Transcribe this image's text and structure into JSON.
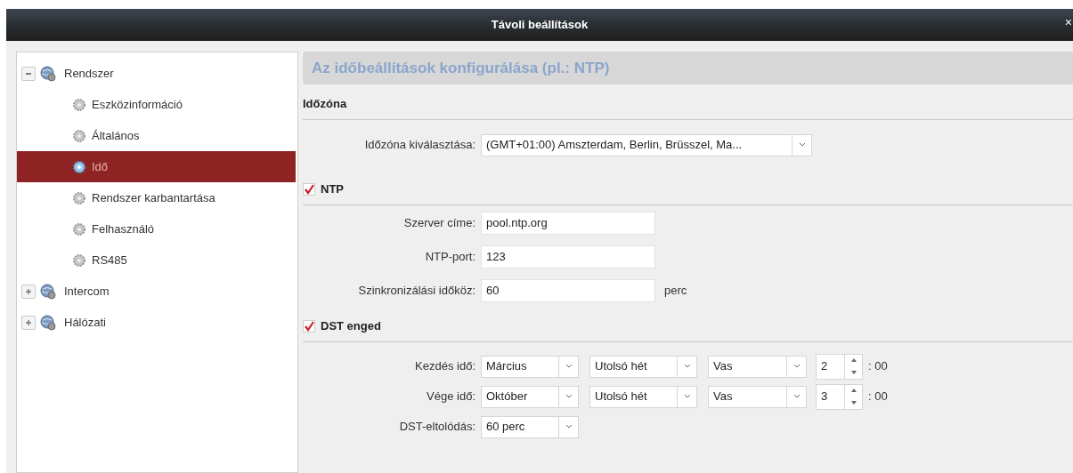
{
  "window": {
    "title": "Távoli beállítások",
    "close": "×"
  },
  "sidebar": {
    "items": [
      {
        "label": "Rendszer",
        "expanded": true,
        "selected": false,
        "children": [
          {
            "label": "Eszközinformáció",
            "selected": false
          },
          {
            "label": "Általános",
            "selected": false
          },
          {
            "label": "Idő",
            "selected": true
          },
          {
            "label": "Rendszer karbantartása",
            "selected": false
          },
          {
            "label": "Felhasználó",
            "selected": false
          },
          {
            "label": "RS485",
            "selected": false
          }
        ]
      },
      {
        "label": "Intercom",
        "expanded": false,
        "selected": false
      },
      {
        "label": "Hálózati",
        "expanded": false,
        "selected": false
      }
    ]
  },
  "content": {
    "header": "Az időbeállítások konfigurálása (pl.: NTP)",
    "timezone_section": {
      "title": "Időzóna",
      "label": "Időzóna kiválasztása:",
      "value": "(GMT+01:00) Amszterdam, Berlin, Brüsszel, Ma..."
    },
    "ntp_section": {
      "title": "NTP",
      "checked": true,
      "fields": [
        {
          "label": "Szerver címe:",
          "value": "pool.ntp.org"
        },
        {
          "label": "NTP-port:",
          "value": "123"
        },
        {
          "label": "Szinkronizálási időköz:",
          "value": "60",
          "unit": "perc"
        }
      ]
    },
    "dst_section": {
      "title": "DST enged",
      "checked": true,
      "rows": [
        {
          "label": "Kezdés idő:",
          "month": "Március",
          "week": "Utolsó hét",
          "day": "Vas",
          "hour": "2",
          "minutes": ": 00"
        },
        {
          "label": "Vége idő:",
          "month": "Október",
          "week": "Utolsó hét",
          "day": "Vas",
          "hour": "3",
          "minutes": ": 00"
        }
      ],
      "offset": {
        "label": "DST-eltolódás:",
        "value": "60 perc"
      }
    }
  }
}
